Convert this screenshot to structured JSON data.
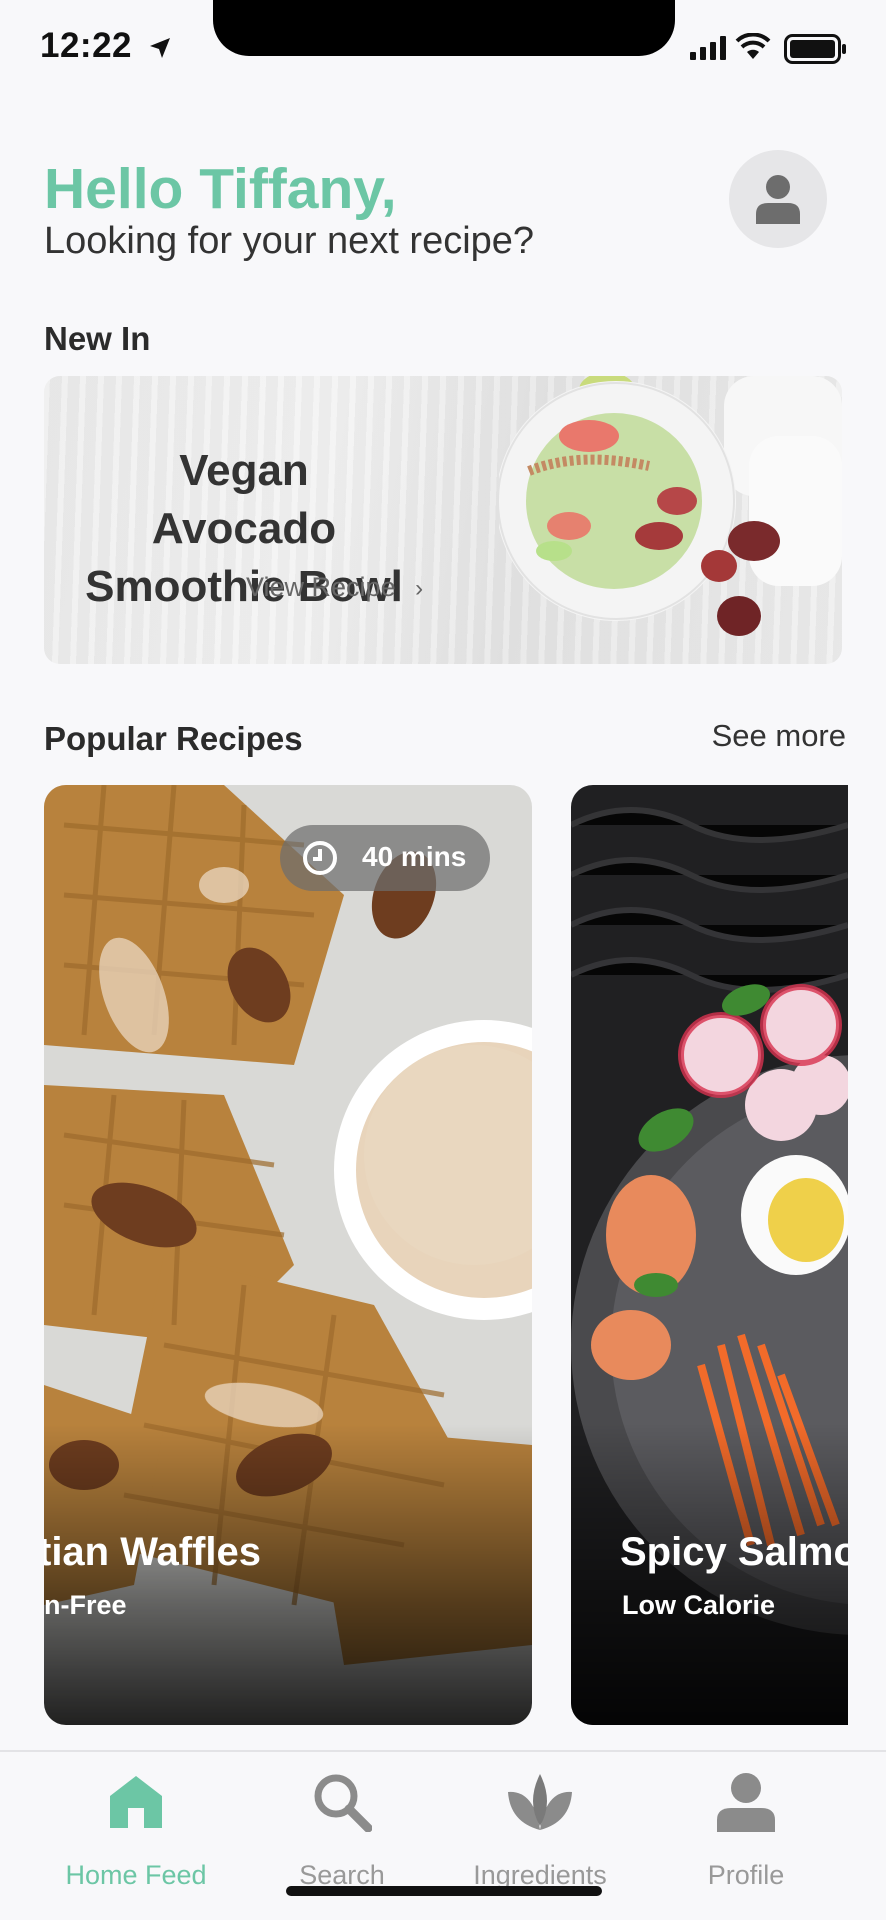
{
  "status_bar": {
    "time": "12:22"
  },
  "header": {
    "greeting": "Hello Tiffany,",
    "subtitle": "Looking for your next recipe?"
  },
  "new_in": {
    "section_title": "New In",
    "title": "Vegan Avocado Smoothie Bowl",
    "link_label": "View Recipe",
    "link_arrow": "›"
  },
  "popular": {
    "section_title": "Popular Recipes",
    "see_more": "See more",
    "cards": [
      {
        "title": "tian Waffles",
        "tag": "n-Free",
        "time": "40 mins"
      },
      {
        "title": "Spicy Salmo",
        "tag": "Low Calorie"
      }
    ]
  },
  "tabs": [
    {
      "label": "Home Feed",
      "icon": "home-icon",
      "active": true
    },
    {
      "label": "Search",
      "icon": "search-icon",
      "active": false
    },
    {
      "label": "Ingredients",
      "icon": "leaf-icon",
      "active": false
    },
    {
      "label": "Profile",
      "icon": "profile-icon",
      "active": false
    }
  ],
  "colors": {
    "accent": "#6cc6a5",
    "inactive": "#999999"
  }
}
